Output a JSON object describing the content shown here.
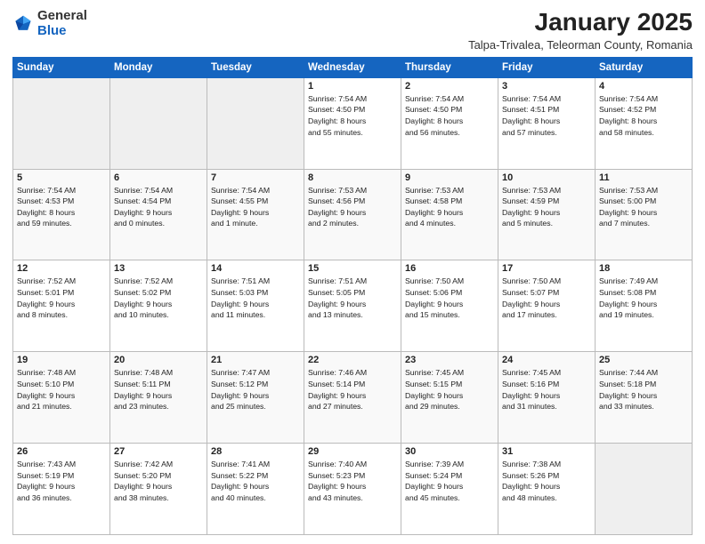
{
  "header": {
    "logo_general": "General",
    "logo_blue": "Blue",
    "title": "January 2025",
    "location": "Talpa-Trivalea, Teleorman County, Romania"
  },
  "weekdays": [
    "Sunday",
    "Monday",
    "Tuesday",
    "Wednesday",
    "Thursday",
    "Friday",
    "Saturday"
  ],
  "weeks": [
    [
      {
        "day": "",
        "info": ""
      },
      {
        "day": "",
        "info": ""
      },
      {
        "day": "",
        "info": ""
      },
      {
        "day": "1",
        "info": "Sunrise: 7:54 AM\nSunset: 4:50 PM\nDaylight: 8 hours\nand 55 minutes."
      },
      {
        "day": "2",
        "info": "Sunrise: 7:54 AM\nSunset: 4:50 PM\nDaylight: 8 hours\nand 56 minutes."
      },
      {
        "day": "3",
        "info": "Sunrise: 7:54 AM\nSunset: 4:51 PM\nDaylight: 8 hours\nand 57 minutes."
      },
      {
        "day": "4",
        "info": "Sunrise: 7:54 AM\nSunset: 4:52 PM\nDaylight: 8 hours\nand 58 minutes."
      }
    ],
    [
      {
        "day": "5",
        "info": "Sunrise: 7:54 AM\nSunset: 4:53 PM\nDaylight: 8 hours\nand 59 minutes."
      },
      {
        "day": "6",
        "info": "Sunrise: 7:54 AM\nSunset: 4:54 PM\nDaylight: 9 hours\nand 0 minutes."
      },
      {
        "day": "7",
        "info": "Sunrise: 7:54 AM\nSunset: 4:55 PM\nDaylight: 9 hours\nand 1 minute."
      },
      {
        "day": "8",
        "info": "Sunrise: 7:53 AM\nSunset: 4:56 PM\nDaylight: 9 hours\nand 2 minutes."
      },
      {
        "day": "9",
        "info": "Sunrise: 7:53 AM\nSunset: 4:58 PM\nDaylight: 9 hours\nand 4 minutes."
      },
      {
        "day": "10",
        "info": "Sunrise: 7:53 AM\nSunset: 4:59 PM\nDaylight: 9 hours\nand 5 minutes."
      },
      {
        "day": "11",
        "info": "Sunrise: 7:53 AM\nSunset: 5:00 PM\nDaylight: 9 hours\nand 7 minutes."
      }
    ],
    [
      {
        "day": "12",
        "info": "Sunrise: 7:52 AM\nSunset: 5:01 PM\nDaylight: 9 hours\nand 8 minutes."
      },
      {
        "day": "13",
        "info": "Sunrise: 7:52 AM\nSunset: 5:02 PM\nDaylight: 9 hours\nand 10 minutes."
      },
      {
        "day": "14",
        "info": "Sunrise: 7:51 AM\nSunset: 5:03 PM\nDaylight: 9 hours\nand 11 minutes."
      },
      {
        "day": "15",
        "info": "Sunrise: 7:51 AM\nSunset: 5:05 PM\nDaylight: 9 hours\nand 13 minutes."
      },
      {
        "day": "16",
        "info": "Sunrise: 7:50 AM\nSunset: 5:06 PM\nDaylight: 9 hours\nand 15 minutes."
      },
      {
        "day": "17",
        "info": "Sunrise: 7:50 AM\nSunset: 5:07 PM\nDaylight: 9 hours\nand 17 minutes."
      },
      {
        "day": "18",
        "info": "Sunrise: 7:49 AM\nSunset: 5:08 PM\nDaylight: 9 hours\nand 19 minutes."
      }
    ],
    [
      {
        "day": "19",
        "info": "Sunrise: 7:48 AM\nSunset: 5:10 PM\nDaylight: 9 hours\nand 21 minutes."
      },
      {
        "day": "20",
        "info": "Sunrise: 7:48 AM\nSunset: 5:11 PM\nDaylight: 9 hours\nand 23 minutes."
      },
      {
        "day": "21",
        "info": "Sunrise: 7:47 AM\nSunset: 5:12 PM\nDaylight: 9 hours\nand 25 minutes."
      },
      {
        "day": "22",
        "info": "Sunrise: 7:46 AM\nSunset: 5:14 PM\nDaylight: 9 hours\nand 27 minutes."
      },
      {
        "day": "23",
        "info": "Sunrise: 7:45 AM\nSunset: 5:15 PM\nDaylight: 9 hours\nand 29 minutes."
      },
      {
        "day": "24",
        "info": "Sunrise: 7:45 AM\nSunset: 5:16 PM\nDaylight: 9 hours\nand 31 minutes."
      },
      {
        "day": "25",
        "info": "Sunrise: 7:44 AM\nSunset: 5:18 PM\nDaylight: 9 hours\nand 33 minutes."
      }
    ],
    [
      {
        "day": "26",
        "info": "Sunrise: 7:43 AM\nSunset: 5:19 PM\nDaylight: 9 hours\nand 36 minutes."
      },
      {
        "day": "27",
        "info": "Sunrise: 7:42 AM\nSunset: 5:20 PM\nDaylight: 9 hours\nand 38 minutes."
      },
      {
        "day": "28",
        "info": "Sunrise: 7:41 AM\nSunset: 5:22 PM\nDaylight: 9 hours\nand 40 minutes."
      },
      {
        "day": "29",
        "info": "Sunrise: 7:40 AM\nSunset: 5:23 PM\nDaylight: 9 hours\nand 43 minutes."
      },
      {
        "day": "30",
        "info": "Sunrise: 7:39 AM\nSunset: 5:24 PM\nDaylight: 9 hours\nand 45 minutes."
      },
      {
        "day": "31",
        "info": "Sunrise: 7:38 AM\nSunset: 5:26 PM\nDaylight: 9 hours\nand 48 minutes."
      },
      {
        "day": "",
        "info": ""
      }
    ]
  ]
}
